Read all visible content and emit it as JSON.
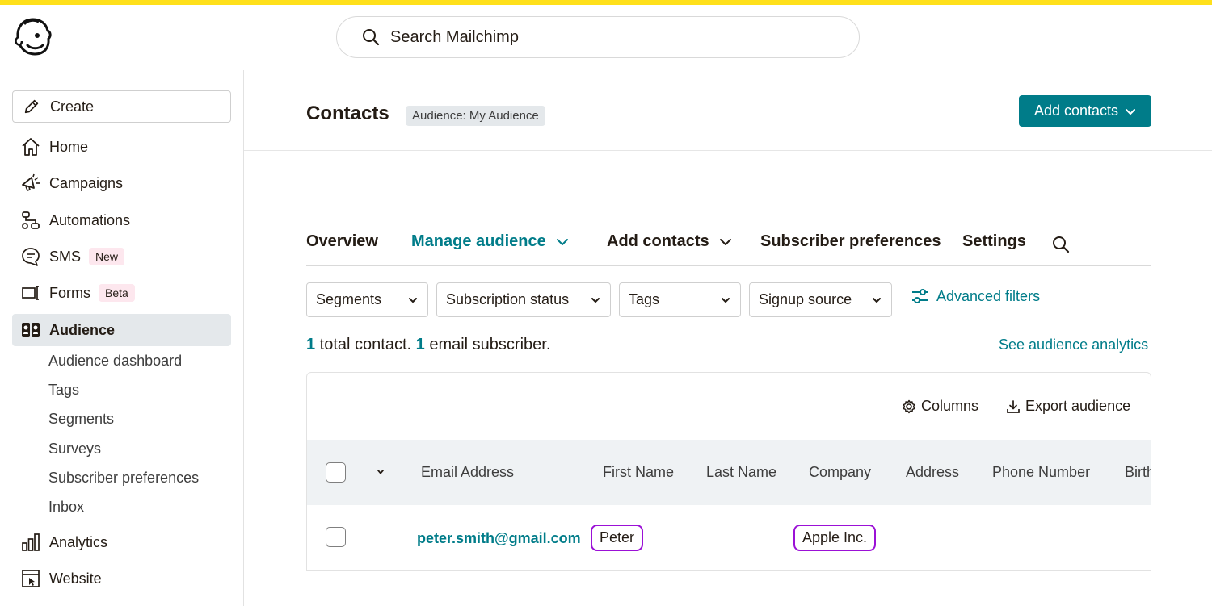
{
  "header": {
    "search_placeholder": "Search Mailchimp"
  },
  "sidebar": {
    "create_label": "Create",
    "items": [
      {
        "label": "Home",
        "icon": "home-icon"
      },
      {
        "label": "Campaigns",
        "icon": "megaphone-icon"
      },
      {
        "label": "Automations",
        "icon": "automation-icon"
      },
      {
        "label": "SMS",
        "icon": "sms-icon",
        "badge": "New"
      },
      {
        "label": "Forms",
        "icon": "forms-icon",
        "badge": "Beta"
      },
      {
        "label": "Audience",
        "icon": "audience-icon",
        "active": true
      },
      {
        "label": "Analytics",
        "icon": "bar-chart-icon"
      },
      {
        "label": "Website",
        "icon": "website-icon"
      }
    ],
    "audience_sub": [
      "Audience dashboard",
      "Tags",
      "Segments",
      "Surveys",
      "Subscriber preferences",
      "Inbox"
    ]
  },
  "page": {
    "title": "Contacts",
    "audience_chip": "Audience: My Audience",
    "add_contacts_label": "Add contacts"
  },
  "tabs": [
    "Overview",
    "Manage audience",
    "Add contacts",
    "Subscriber preferences",
    "Settings"
  ],
  "filters": [
    "Segments",
    "Subscription status",
    "Tags",
    "Signup source"
  ],
  "advanced_filters_label": "Advanced filters",
  "totals": {
    "contacts": "1",
    "contacts_text": " total contact. ",
    "subscribers": "1",
    "subscribers_text": " email subscriber."
  },
  "analytics_link": "See audience analytics",
  "table": {
    "columns_label": "Columns",
    "export_label": "Export audience",
    "headers": [
      "Email Address",
      "First Name",
      "Last Name",
      "Company",
      "Address",
      "Phone Number",
      "Birth"
    ],
    "rows": [
      {
        "email": "peter.smith@gmail.com",
        "first_name": "Peter",
        "last_name": "",
        "company": "Apple Inc."
      }
    ]
  },
  "colors": {
    "accent": "#007c89",
    "brand_yellow": "#ffe01b",
    "highlight": "#9b11d6"
  }
}
